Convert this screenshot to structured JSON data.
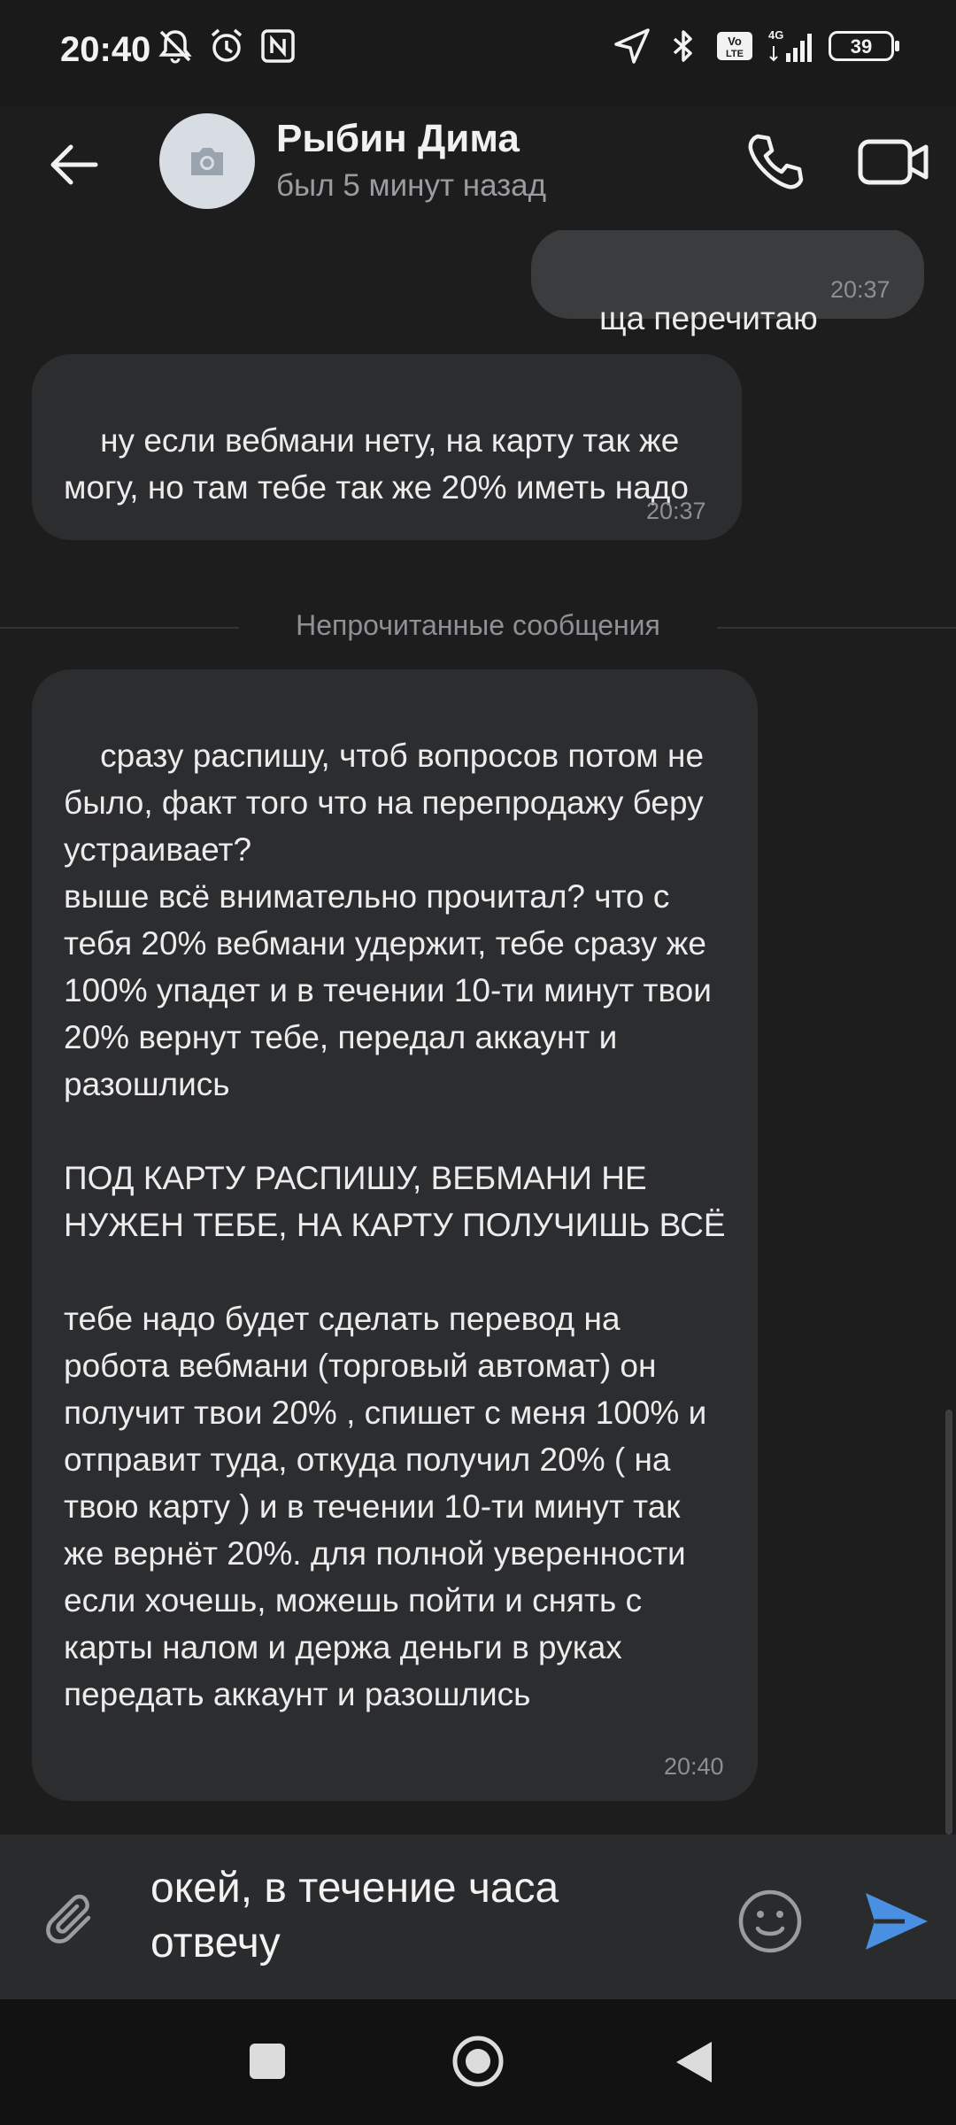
{
  "status_bar": {
    "time": "20:40",
    "battery": "39",
    "network": "4G",
    "volte": "Vo LTE",
    "icons_left": [
      "mute-icon",
      "alarm-icon",
      "nfc-icon"
    ],
    "icons_right": [
      "location-icon",
      "bluetooth-icon",
      "volte-icon",
      "signal-icon",
      "battery-icon"
    ]
  },
  "header": {
    "name": "Рыбин Дима",
    "status": "был 5 минут назад"
  },
  "messages": [
    {
      "direction": "out",
      "text": "ща перечитаю",
      "time": "20:37"
    },
    {
      "direction": "in",
      "text": "ну если вебмани нету, на карту так же могу, но там тебе так же 20% иметь надо",
      "time": "20:37"
    },
    {
      "direction": "in",
      "text": "сразу распишу, чтоб вопросов потом не было, факт того что на перепродажу беру устраивает?\nвыше всё внимательно прочитал? что с тебя 20% вебмани удержит, тебе сразу же 100% упадет и в течении 10-ти минут твои 20% вернут тебе, передал аккаунт и разошлись\n\nПОД КАРТУ РАСПИШУ, ВЕБМАНИ НЕ НУЖЕН ТЕБЕ, НА КАРТУ ПОЛУЧИШЬ ВСЁ\n\nтебе надо будет сделать перевод на робота вебмани (торговый автомат) он получит твои 20% , спишет с меня 100% и отправит туда, откуда получил 20% ( на твою карту ) и в течении 10-ти минут так же вернёт 20%. для полной уверенности если хочешь, можешь пойти и снять с карты налом и держа деньги в руках передать аккаунт и разошлись",
      "time": "20:40"
    }
  ],
  "unread_divider": "Непрочитанные сообщения",
  "composer": {
    "text": "окей, в течение часа отвечу"
  },
  "colors": {
    "background": "#1d1d1e",
    "bubble_in": "#2c2d2f",
    "bubble_out": "#3b3c3e",
    "send_accent": "#4a90e2"
  }
}
